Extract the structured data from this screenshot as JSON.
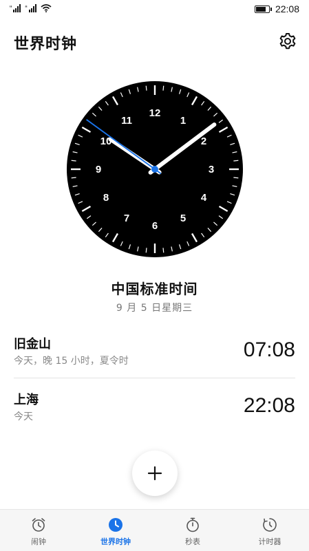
{
  "status_bar": {
    "time": "22:08",
    "signal_1": "“",
    "signal_2": "“",
    "battery_level": 0.85
  },
  "header": {
    "title": "世界时钟",
    "settings_icon": "gear-icon"
  },
  "clock": {
    "numerals": [
      "12",
      "1",
      "2",
      "3",
      "4",
      "5",
      "6",
      "7",
      "8",
      "9",
      "10",
      "11"
    ],
    "hour": 22,
    "minute": 8,
    "second": 51,
    "face_color": "#000000",
    "hand_color": "#ffffff",
    "second_hand_color": "#1a73e8"
  },
  "local": {
    "zone": "中国标准时间",
    "date": "9 月 5 日星期三"
  },
  "cities": [
    {
      "name": "旧金山",
      "detail": "今天，晚 15 小时，夏令时",
      "time": "07:08"
    },
    {
      "name": "上海",
      "detail": "今天",
      "time": "22:08"
    }
  ],
  "add_icon": "plus-icon",
  "nav": {
    "accent": "#1a73e8",
    "items": [
      {
        "label": "闹钟",
        "icon": "alarm-clock-icon",
        "active": false
      },
      {
        "label": "世界时钟",
        "icon": "world-clock-icon",
        "active": true
      },
      {
        "label": "秒表",
        "icon": "stopwatch-icon",
        "active": false
      },
      {
        "label": "计时器",
        "icon": "timer-icon",
        "active": false
      }
    ]
  }
}
